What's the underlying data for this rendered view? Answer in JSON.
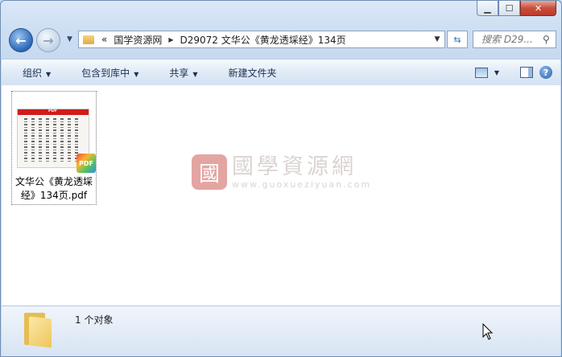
{
  "window": {
    "caption_buttons": [
      "minimize",
      "maximize",
      "close"
    ]
  },
  "address_bar": {
    "history_glyph": "«",
    "crumbs": [
      "国学资源网",
      "D29072 文华公《黄龙透埰经》134页"
    ],
    "search_placeholder": "搜索 D29..."
  },
  "toolbar": {
    "organize": "组织",
    "include_in_library": "包含到库中",
    "share": "共享",
    "new_folder": "新建文件夹"
  },
  "files": [
    {
      "name": "文华公《黄龙透埰经》134页.pdf",
      "thumb_header": "PDF",
      "badge": "PDF"
    }
  ],
  "watermark": {
    "seal": "國",
    "title": "國學資源網",
    "url": "www.guoxueziyuan.com"
  },
  "details": {
    "count_text": "1 个对象"
  },
  "colors": {
    "frame": "#c6d9ef",
    "close_button": "#c7503a",
    "pdf_header": "#d21b1b"
  }
}
